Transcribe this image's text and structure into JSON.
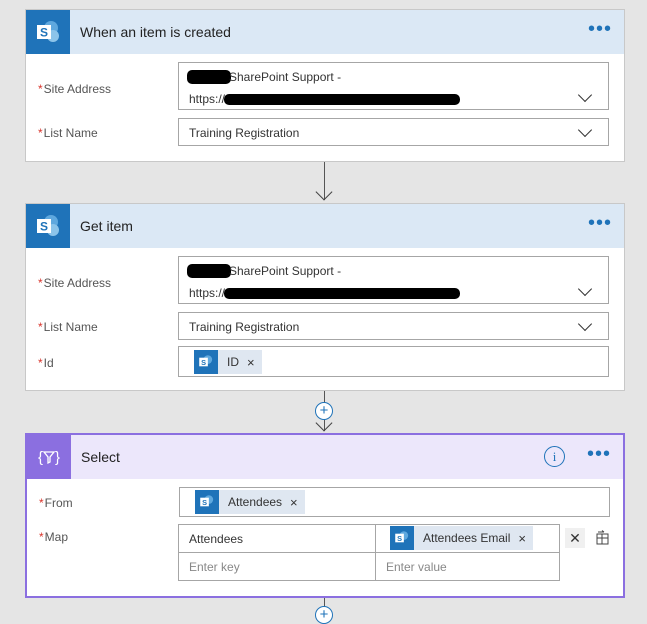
{
  "trigger": {
    "title": "When an item is created",
    "site_label": "Site Address",
    "site_value_line1": "SharePoint Support -",
    "site_value_line2": "https://",
    "list_label": "List Name",
    "list_value": "Training Registration"
  },
  "get_item": {
    "title": "Get item",
    "site_label": "Site Address",
    "site_value_line1": "SharePoint Support -",
    "site_value_line2": "https://",
    "list_label": "List Name",
    "list_value": "Training Registration",
    "id_label": "Id",
    "id_token": "ID"
  },
  "select": {
    "title": "Select",
    "from_label": "From",
    "from_token": "Attendees",
    "map_label": "Map",
    "map_key": "Attendees",
    "map_value_token": "Attendees Email",
    "key_placeholder": "Enter key",
    "value_placeholder": "Enter value"
  },
  "common": {
    "required_mark": "*",
    "more_dots": "•••",
    "token_remove": "×",
    "info_glyph": "i",
    "plus_glyph": "+",
    "row_remove": "✕"
  },
  "colors": {
    "sharepoint_blue": "#1f73b9",
    "select_purple": "#8b6fe0",
    "required_red": "#d9342b"
  },
  "icons": [
    "sharepoint-icon",
    "select-filter-icon",
    "info-icon",
    "more-icon",
    "chevron-down-icon",
    "delete-row-icon",
    "switch-mode-icon",
    "add-step-icon"
  ]
}
